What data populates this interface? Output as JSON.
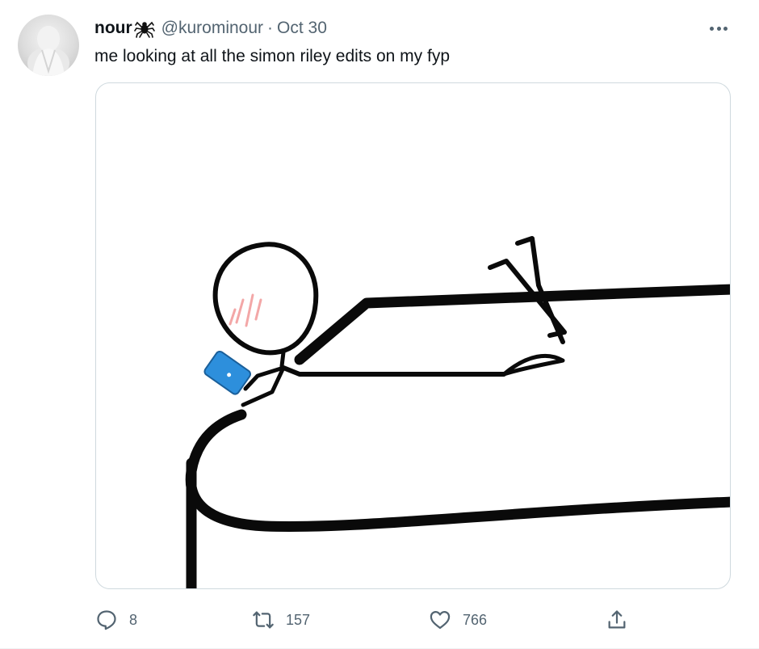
{
  "tweet": {
    "display_name": "nour",
    "handle": "@kurominour",
    "separator": "·",
    "date": "Oct 30",
    "text": "me looking at all the simon riley edits on my fyp",
    "avatar_icon": "user-avatar",
    "media_icon": "stickman-phone-drawing"
  },
  "actions": {
    "reply_count": "8",
    "retweet_count": "157",
    "like_count": "766",
    "reply_icon": "speech-bubble-icon",
    "retweet_icon": "retweet-arrows-icon",
    "like_icon": "heart-outline-icon",
    "share_icon": "share-upload-icon"
  },
  "colors": {
    "text_primary": "#0f1419",
    "text_secondary": "#536471",
    "border": "#cfd9de",
    "phone_blue": "#2d8fdc",
    "blush_pink": "#f3a7a7"
  }
}
